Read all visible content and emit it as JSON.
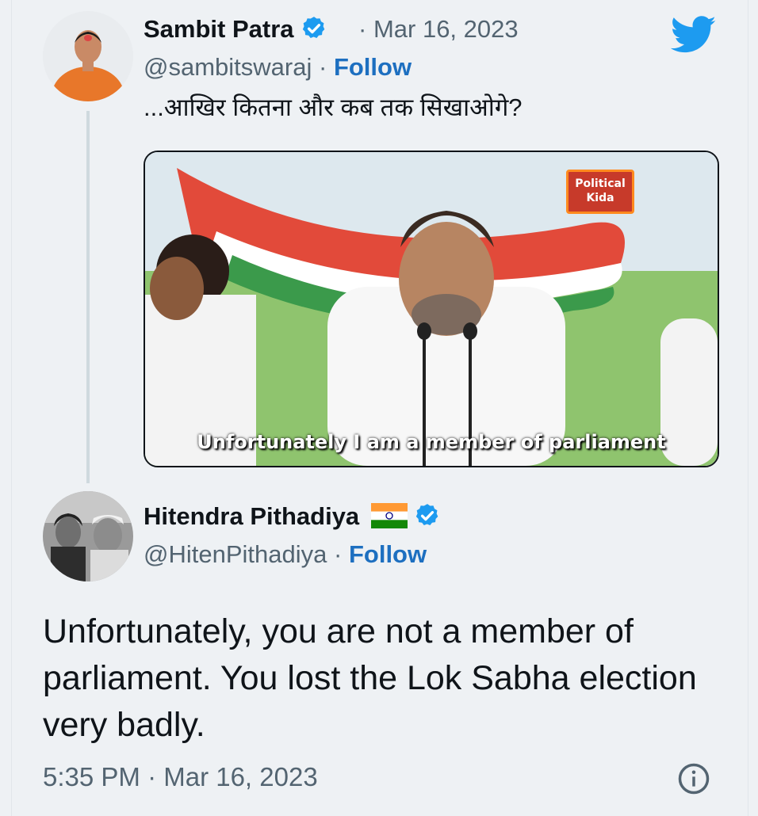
{
  "tweet1": {
    "name": "Sambit Patra",
    "handle": "@sambitswaraj",
    "separator": "·",
    "follow_label": "Follow",
    "date": "Mar 16, 2023",
    "text": "...आखिर कितना और कब तक सिखाओगे?",
    "media_caption": "Unfortunately I am a member of parliament",
    "media_tag": "Political Kida"
  },
  "tweet2": {
    "name": "Hitendra Pithadiya",
    "handle": "@HitenPithadiya",
    "separator": "·",
    "follow_label": "Follow",
    "text": "Unfortunately, you are not a member of parliament. You lost the Lok Sabha election very badly.",
    "timestamp": "5:35 PM · Mar 16, 2023"
  },
  "icons": {
    "verified": "verified-badge-icon",
    "brand": "twitter-bird-icon",
    "info": "info-icon",
    "flag": "india-flag-icon"
  },
  "colors": {
    "accent": "#1d9bf0",
    "follow": "#1d6fc0",
    "muted": "#536471",
    "background": "#eef1f4"
  }
}
